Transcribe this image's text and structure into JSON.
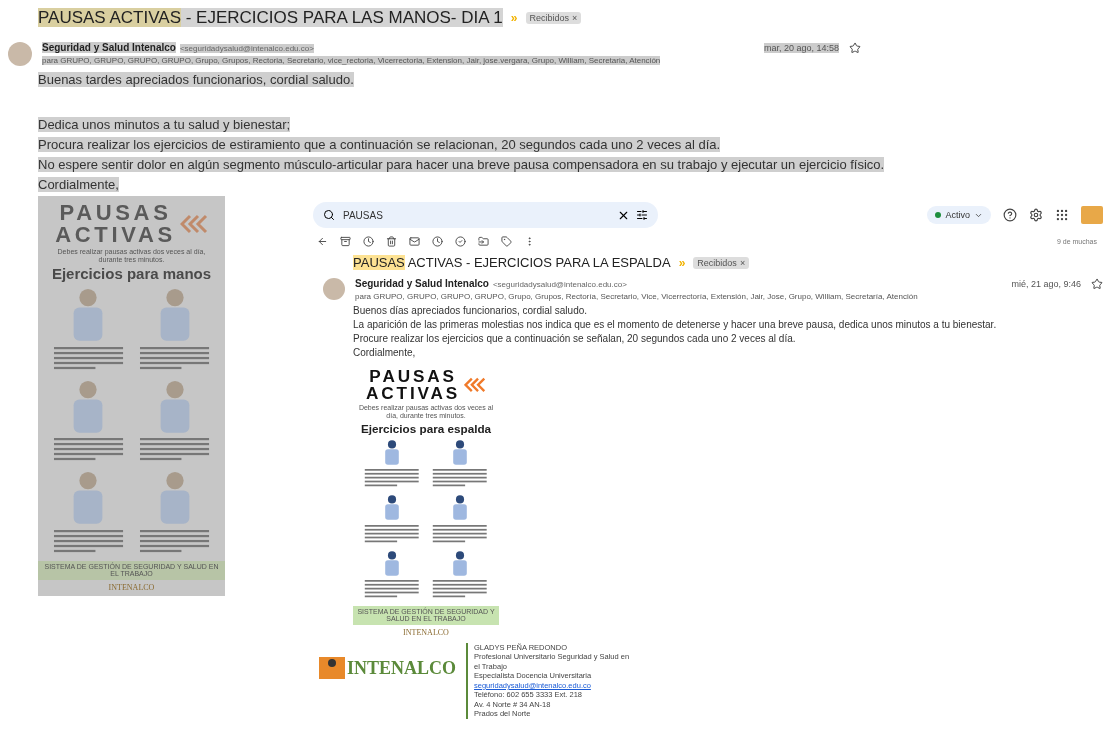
{
  "email": {
    "subject_match": "PAUSAS ACTIVAS",
    "subject_rest": " - EJERCICIOS PARA LAS MANOS- DIA 1",
    "separator": "»",
    "label": "Recibidos",
    "label_close": "×",
    "sender": "Seguridad y Salud Intenalco",
    "sender_email": "<seguridadysalud@intenalco.edu.co>",
    "recipients": "para GRUPO, GRUPO, GRUPO, GRUPO, Grupo, Grupos, Rectoria, Secretario, vice_rectoria, Vicerrectoria, Extension, Jair, jose.vergara, Grupo, William, Secretaria, Atención",
    "date": "mar, 20 ago, 14:58",
    "starred": false,
    "body": [
      "Buenas tardes apreciados funcionarios, cordial saludo.",
      "Dedica unos minutos a tu salud y bienestar;",
      "Procura realizar los ejercicios de estiramiento que a continuación se relacionan, 20 segundos cada uno  2 veces al día.",
      "No espere sentir dolor en algún segmento músculo-articular para hacer una breve pausa compensadora en su trabajo y ejecutar un ejercicio físico.",
      "Cordialmente,"
    ],
    "infographic": {
      "title_1": "PAUSAS",
      "title_2": "ACTIVAS",
      "intro": "Debes realizar pausas activas dos veces al día, durante tres minutos.",
      "heading": "Ejercicios para manos",
      "footer": "SISTEMA DE GESTIÓN DE SEGURIDAD Y SALUD EN EL TRABAJO",
      "brand": "INTENALCO"
    }
  },
  "screenshot": {
    "search": {
      "value": "PAUSAS"
    },
    "status": "Activo",
    "count": "9 de muchas",
    "email": {
      "subject_match": "PAUSAS",
      "subject_rest": " ACTIVAS - EJERCICIOS PARA LA ESPALDA",
      "separator": "»",
      "label": "Recibidos",
      "label_close": "×",
      "sender": "Seguridad y Salud Intenalco",
      "sender_email": "<seguridadysalud@intenalco.edu.co>",
      "recipients": "para GRUPO, GRUPO, GRUPO, GRUPO, Grupo, Grupos, Rectoría, Secretario, Vice, Vicerrectoría, Extensión, Jair, Jose, Grupo, William, Secretaría, Atención",
      "date": "mié, 21 ago, 9:46",
      "starred": false,
      "body": [
        "Buenos días apreciados funcionarios, cordial saludo.",
        "La aparición de las primeras molestias nos indica que es el momento de detenerse y hacer una breve pausa, dedica unos minutos a tu bienestar.",
        "Procure realizar los ejercicios que a continuación se señalan, 20 segundos cada uno 2 veces al día.",
        "Cordialmente,"
      ],
      "infographic": {
        "title_1": "PAUSAS",
        "title_2": "ACTIVAS",
        "intro": "Debes realizar pausas activas dos veces al día, durante tres minutos.",
        "heading": "Ejercicios para espalda",
        "footer": "SISTEMA DE GESTIÓN DE SEGURIDAD Y SALUD EN EL TRABAJO",
        "brand": "INTENALCO"
      },
      "signature": {
        "logo": "INTENALCO",
        "lines": [
          "GLADYS PEÑA REDONDO",
          "Profesional Universitario Seguridad y Salud en el Trabajo",
          "Especialista Docencia Universitaria"
        ],
        "link": "seguridadysalud@intenalco.edu.co",
        "contact": [
          "Teléfono: 602 655 3333 Ext. 218",
          "Av. 4 Norte # 34 AN-18",
          "Prados del Norte"
        ]
      }
    }
  }
}
